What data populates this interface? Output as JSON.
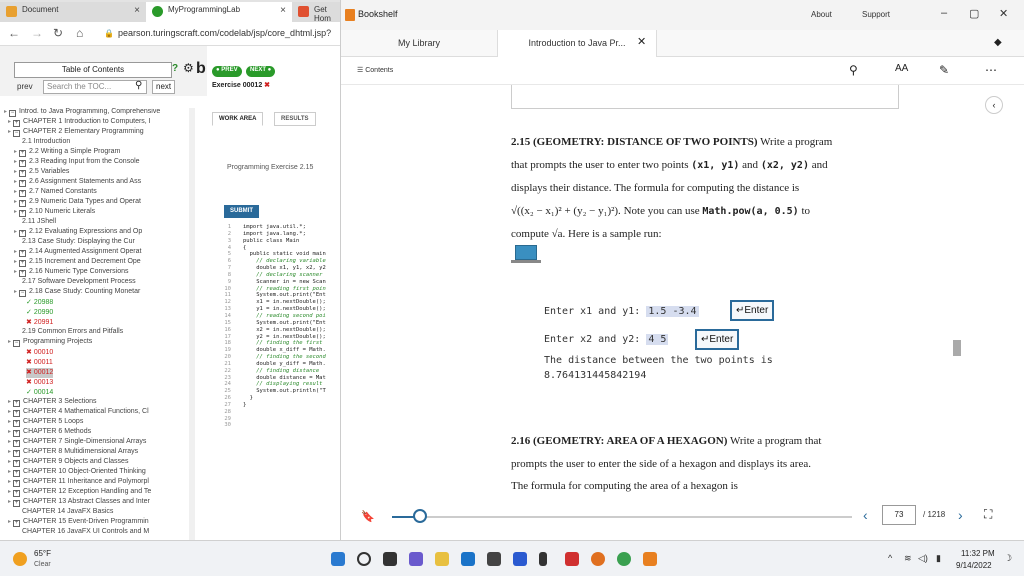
{
  "browser": {
    "tabs": [
      {
        "title": "Document",
        "color": "#e8a030"
      },
      {
        "title": "MyProgrammingLab",
        "color": "#2a9a2a"
      },
      {
        "title": "Get Hom",
        "color": "#e05030"
      }
    ],
    "url": "pearson.turingscraft.com/codelab/jsp/core_dhtml.jsp?"
  },
  "codelab": {
    "toc_title": "Table of Contents",
    "prev": "prev",
    "search_placeholder": "Search the TOC...",
    "next": "next",
    "help": "?",
    "big_letter": "b",
    "prev_pill": "PREV",
    "next_pill": "NEXT",
    "exercise_label": "Exercise 00012",
    "exercise_mark": "✖",
    "toc": [
      {
        "text": "Introd. to Java Programming, Comprehensive",
        "style": "box",
        "mark": "−"
      },
      {
        "text": "CHAPTER 1 Introduction to Computers, I",
        "style": "box",
        "mark": "+"
      },
      {
        "text": "CHAPTER 2 Elementary Programming",
        "style": "box",
        "mark": "−"
      },
      {
        "text": "2.1 Introduction",
        "style": "plain"
      },
      {
        "text": "2.2 Writing a Simple Program",
        "style": "box",
        "mark": "+"
      },
      {
        "text": "2.3 Reading Input from the Console",
        "style": "box",
        "mark": "+"
      },
      {
        "text": "2.5 Variables",
        "style": "box",
        "mark": "+"
      },
      {
        "text": "2.6 Assignment Statements and Ass",
        "style": "box",
        "mark": "+"
      },
      {
        "text": "2.7 Named Constants",
        "style": "box",
        "mark": "+"
      },
      {
        "text": "2.9 Numeric Data Types and Operat",
        "style": "box",
        "mark": "+"
      },
      {
        "text": "2.10 Numeric Literals",
        "style": "box",
        "mark": "+"
      },
      {
        "text": "2.11 JShell",
        "style": "plain"
      },
      {
        "text": "2.12 Evaluating Expressions and Op",
        "style": "box",
        "mark": "+"
      },
      {
        "text": "2.13 Case Study: Displaying the Cur",
        "style": "plain"
      },
      {
        "text": "2.14 Augmented Assignment Operat",
        "style": "box",
        "mark": "+"
      },
      {
        "text": "2.15 Increment and Decrement Ope",
        "style": "box",
        "mark": "+"
      },
      {
        "text": "2.16 Numeric Type Conversions",
        "style": "box",
        "mark": "+"
      },
      {
        "text": "2.17 Software Development Process",
        "style": "plain"
      },
      {
        "text": "2.18 Case Study: Counting Monetar",
        "style": "box",
        "mark": "−"
      },
      {
        "text": "20988",
        "style": "green",
        "mark": "✓"
      },
      {
        "text": "20990",
        "style": "green",
        "mark": "✓"
      },
      {
        "text": "20991",
        "style": "red",
        "mark": "✖"
      },
      {
        "text": "2.19 Common Errors and Pitfalls",
        "style": "plain"
      },
      {
        "text": "Programming Projects",
        "style": "box",
        "mark": "−"
      },
      {
        "text": "00010",
        "style": "red",
        "mark": "✖"
      },
      {
        "text": "00011",
        "style": "red",
        "mark": "✖"
      },
      {
        "text": "00012",
        "style": "red",
        "mark": "✖",
        "hl": true
      },
      {
        "text": "00013",
        "style": "red",
        "mark": "✖"
      },
      {
        "text": "00014",
        "style": "green",
        "mark": "✓"
      },
      {
        "text": "CHAPTER 3 Selections",
        "style": "box",
        "mark": "+"
      },
      {
        "text": "CHAPTER 4 Mathematical Functions, Cl",
        "style": "box",
        "mark": "+"
      },
      {
        "text": "CHAPTER 5 Loops",
        "style": "box",
        "mark": "+"
      },
      {
        "text": "CHAPTER 6 Methods",
        "style": "box",
        "mark": "+"
      },
      {
        "text": "CHAPTER 7 Single-Dimensional Arrays",
        "style": "box",
        "mark": "+"
      },
      {
        "text": "CHAPTER 8 Multidimensional Arrays",
        "style": "box",
        "mark": "+"
      },
      {
        "text": "CHAPTER 9 Objects and Classes",
        "style": "box",
        "mark": "+"
      },
      {
        "text": "CHAPTER 10 Object-Oriented Thinking",
        "style": "box",
        "mark": "+"
      },
      {
        "text": "CHAPTER 11 Inheritance and Polymorpl",
        "style": "box",
        "mark": "+"
      },
      {
        "text": "CHAPTER 12 Exception Handling and Te",
        "style": "box",
        "mark": "+"
      },
      {
        "text": "CHAPTER 13 Abstract Classes and Inter",
        "style": "box",
        "mark": "+"
      },
      {
        "text": "CHAPTER 14 JavaFX Basics",
        "style": "plain"
      },
      {
        "text": "CHAPTER 15 Event-Driven Programmin",
        "style": "box",
        "mark": "+"
      },
      {
        "text": "CHAPTER 16 JavaFX UI Controls and M",
        "style": "plain"
      }
    ],
    "work_area_tab": "WORK AREA",
    "results_tab": "RESULTS",
    "programming_exercise": "Programming Exercise 2.15",
    "submit": "SUBMIT",
    "code_lines": [
      "import java.util.*;",
      "import java.lang.*;",
      "",
      "public class Main",
      "{",
      "  public static void main",
      "    // declaring variable",
      "    double x1, y1, x2, y2",
      "    // declaring scanner",
      "    Scanner in = new Scan",
      "    // reading first poin",
      "    System.out.print(\"Ent",
      "    x1 = in.nextDouble();",
      "    y1 = in.nextDouble();",
      "    // reading second poi",
      "    System.out.print(\"Ent",
      "    x2 = in.nextDouble();",
      "    y2 = in.nextDouble();",
      "",
      "    // finding the first",
      "    double x_diff = Math.",
      "    // finding the second",
      "    double y_diff = Math.",
      "    // finding distance",
      "    double distance = Mat",
      "",
      "    // displaying result",
      "    System.out.println(\"T",
      "  }",
      "}"
    ]
  },
  "bookshelf": {
    "app_name": "Bookshelf",
    "about": "About",
    "support": "Support",
    "tab_library": "My Library",
    "tab_book": "Introduction to Java Pr...",
    "contents": "Contents",
    "font_size": "AA",
    "problem_215_title": "2.15 (GEOMETRY: DISTANCE OF TWO POINTS)",
    "problem_215_l1": "Write a program",
    "problem_215_l2a": "that prompts the user to enter two points",
    "problem_215_code1": "(x1, y1)",
    "problem_215_and": "and",
    "problem_215_code2": "(x2, y2)",
    "problem_215_l2b": "and",
    "problem_215_l3": "displays their distance. The formula for computing the distance is",
    "problem_215_formula": "√((x₂ − x₁)² + (y₂ − y₁)²).",
    "problem_215_note": "Note you can use",
    "problem_215_pow": "Math.pow(a, 0.5)",
    "problem_215_to": "to",
    "problem_215_l5": "compute √a. Here is a sample run:",
    "run_line1_prompt": "Enter x1 and y1:",
    "run_line1_input": "1.5 -3.4",
    "run_line2_prompt": "Enter x2 and y2:",
    "run_line2_input": "4 5",
    "enter_key": "↵Enter",
    "run_line3": "The distance between the two points is",
    "run_line4": "8.764131445842194",
    "problem_216_title": "2.16 (GEOMETRY: AREA OF A HEXAGON)",
    "problem_216_l1": "Write a program that",
    "problem_216_l2": "prompts the user to enter the side of a hexagon and displays its area.",
    "problem_216_l3": "The formula for computing the area of a hexagon is",
    "page_current": "73",
    "page_total": "/ 1218",
    "reading_progress": 0.06
  },
  "taskbar": {
    "temp": "65°F",
    "weather": "Clear",
    "time": "11:32 PM",
    "date": "9/14/2022"
  }
}
